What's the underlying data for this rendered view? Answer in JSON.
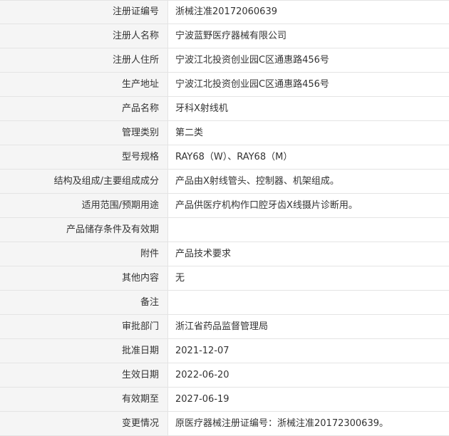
{
  "rows": [
    {
      "label": "注册证编号",
      "value": "浙械注准20172060639"
    },
    {
      "label": "注册人名称",
      "value": "宁波蓝野医疗器械有限公司"
    },
    {
      "label": "注册人住所",
      "value": "宁波江北投资创业园C区通惠路456号"
    },
    {
      "label": "生产地址",
      "value": "宁波江北投资创业园C区通惠路456号"
    },
    {
      "label": "产品名称",
      "value": "牙科X射线机"
    },
    {
      "label": "管理类别",
      "value": "第二类"
    },
    {
      "label": "型号规格",
      "value": "RAY68（W）、RAY68（M）"
    },
    {
      "label": "结构及组成/主要组成成分",
      "value": "产品由X射线管头、控制器、机架组成。"
    },
    {
      "label": "适用范围/预期用途",
      "value": "产品供医疗机构作口腔牙齿X线摄片诊断用。"
    },
    {
      "label": "产品储存条件及有效期",
      "value": ""
    },
    {
      "label": "附件",
      "value": "产品技术要求"
    },
    {
      "label": "其他内容",
      "value": "无"
    },
    {
      "label": "备注",
      "value": ""
    },
    {
      "label": "审批部门",
      "value": "浙江省药品监督管理局"
    },
    {
      "label": "批准日期",
      "value": "2021-12-07"
    },
    {
      "label": "生效日期",
      "value": "2022-06-20"
    },
    {
      "label": "有效期至",
      "value": "2027-06-19"
    },
    {
      "label": "变更情况",
      "value": "原医疗器械注册证编号：浙械注准20172300639。"
    }
  ]
}
